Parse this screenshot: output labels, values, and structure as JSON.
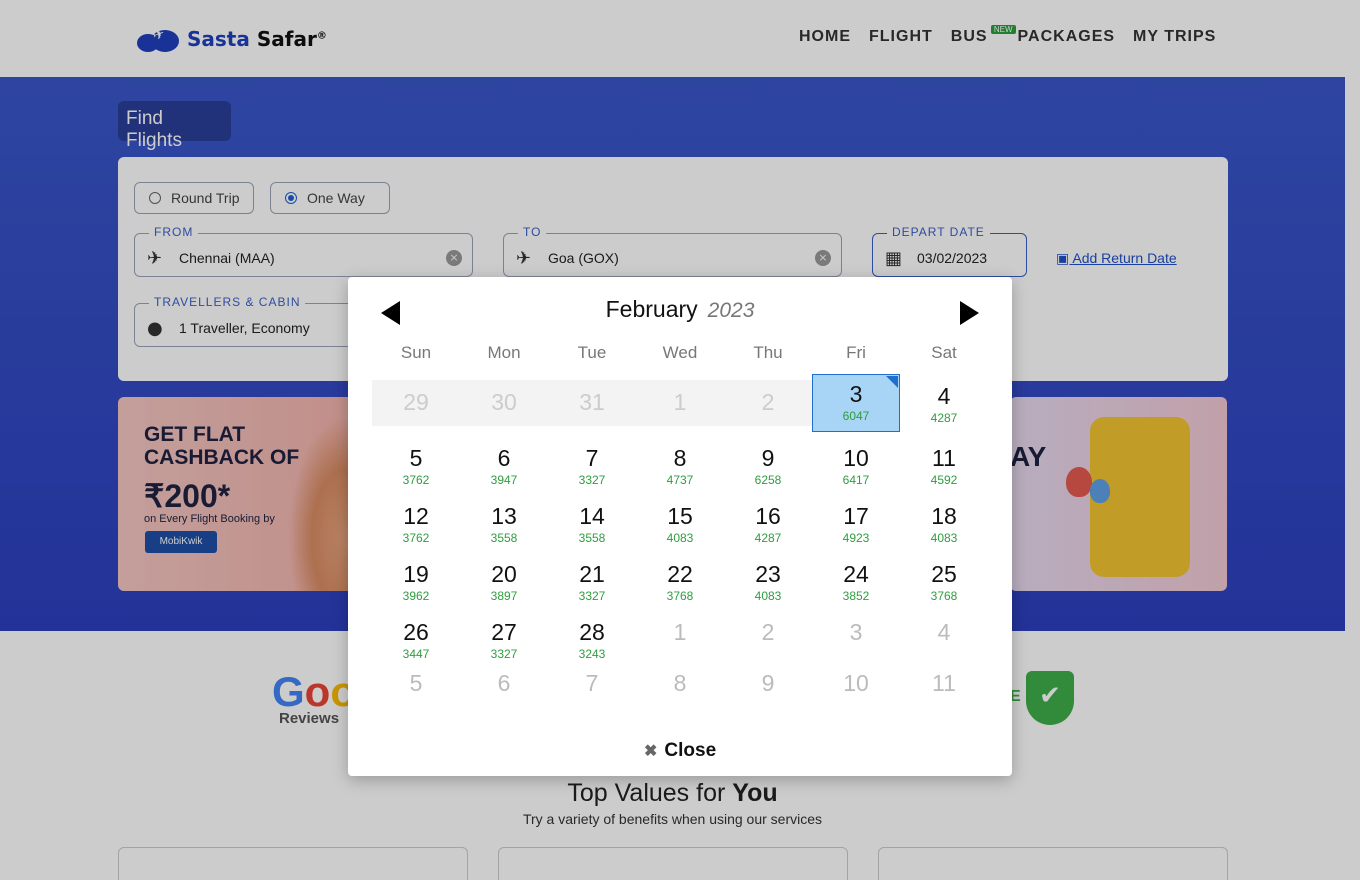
{
  "header": {
    "logo_part1": "Sasta",
    "logo_part2": "Safar",
    "logo_reg": "®",
    "nav": [
      "HOME",
      "FLIGHT",
      "BUS",
      "PACKAGES",
      "MY TRIPS"
    ],
    "new_badge": "NEW"
  },
  "search": {
    "title": "Find Flights",
    "round_trip": "Round Trip",
    "one_way": "One Way",
    "selected_trip": "One Way",
    "from_label": "FROM",
    "from_value": "Chennai (MAA)",
    "to_label": "TO",
    "to_value": "Goa (GOX)",
    "depart_label": "DEPART DATE",
    "depart_value": "03/02/2023",
    "add_return": "Add Return Date",
    "travellers_label": "TRAVELLERS & CABIN",
    "travellers_value": "1 Traveller, Economy"
  },
  "banners": {
    "left_line1": "GET FLAT",
    "left_line2": "CASHBACK OF",
    "left_amount": "₹200*",
    "left_sub": "on Every Flight Booking by",
    "left_brand": "MobiKwik",
    "right_text": "AY"
  },
  "reviews": {
    "google_text": "Goo",
    "reviews_label": "Reviews",
    "shield_text": "E"
  },
  "values": {
    "title_prefix": "Top Values for",
    "title_bold": "You",
    "subtitle": "Try a variety of benefits when using our services"
  },
  "calendar": {
    "month": "February",
    "year": "2023",
    "weekdays": [
      "Sun",
      "Mon",
      "Tue",
      "Wed",
      "Thu",
      "Fri",
      "Sat"
    ],
    "weeks": [
      [
        {
          "n": "29",
          "p": "",
          "s": "past"
        },
        {
          "n": "30",
          "p": "",
          "s": "past"
        },
        {
          "n": "31",
          "p": "",
          "s": "past"
        },
        {
          "n": "1",
          "p": "",
          "s": "past"
        },
        {
          "n": "2",
          "p": "",
          "s": "past"
        },
        {
          "n": "3",
          "p": "6047",
          "s": "selected"
        },
        {
          "n": "4",
          "p": "4287",
          "s": ""
        }
      ],
      [
        {
          "n": "5",
          "p": "3762",
          "s": ""
        },
        {
          "n": "6",
          "p": "3947",
          "s": ""
        },
        {
          "n": "7",
          "p": "3327",
          "s": ""
        },
        {
          "n": "8",
          "p": "4737",
          "s": ""
        },
        {
          "n": "9",
          "p": "6258",
          "s": ""
        },
        {
          "n": "10",
          "p": "6417",
          "s": ""
        },
        {
          "n": "11",
          "p": "4592",
          "s": ""
        }
      ],
      [
        {
          "n": "12",
          "p": "3762",
          "s": ""
        },
        {
          "n": "13",
          "p": "3558",
          "s": ""
        },
        {
          "n": "14",
          "p": "3558",
          "s": ""
        },
        {
          "n": "15",
          "p": "4083",
          "s": ""
        },
        {
          "n": "16",
          "p": "4287",
          "s": ""
        },
        {
          "n": "17",
          "p": "4923",
          "s": ""
        },
        {
          "n": "18",
          "p": "4083",
          "s": ""
        }
      ],
      [
        {
          "n": "19",
          "p": "3962",
          "s": ""
        },
        {
          "n": "20",
          "p": "3897",
          "s": ""
        },
        {
          "n": "21",
          "p": "3327",
          "s": ""
        },
        {
          "n": "22",
          "p": "3768",
          "s": ""
        },
        {
          "n": "23",
          "p": "4083",
          "s": ""
        },
        {
          "n": "24",
          "p": "3852",
          "s": ""
        },
        {
          "n": "25",
          "p": "3768",
          "s": ""
        }
      ],
      [
        {
          "n": "26",
          "p": "3447",
          "s": ""
        },
        {
          "n": "27",
          "p": "3327",
          "s": ""
        },
        {
          "n": "28",
          "p": "3243",
          "s": ""
        },
        {
          "n": "1",
          "p": "",
          "s": "muted"
        },
        {
          "n": "2",
          "p": "",
          "s": "muted"
        },
        {
          "n": "3",
          "p": "",
          "s": "muted"
        },
        {
          "n": "4",
          "p": "",
          "s": "muted"
        }
      ],
      [
        {
          "n": "5",
          "p": "",
          "s": "muted"
        },
        {
          "n": "6",
          "p": "",
          "s": "muted"
        },
        {
          "n": "7",
          "p": "",
          "s": "muted"
        },
        {
          "n": "8",
          "p": "",
          "s": "muted"
        },
        {
          "n": "9",
          "p": "",
          "s": "muted"
        },
        {
          "n": "10",
          "p": "",
          "s": "muted"
        },
        {
          "n": "11",
          "p": "",
          "s": "muted"
        }
      ]
    ],
    "close_label": "Close"
  },
  "colors": {
    "brand_blue": "#1f3fbf",
    "price_green": "#2e9e3e",
    "selected_bg": "#a8d4f5"
  }
}
